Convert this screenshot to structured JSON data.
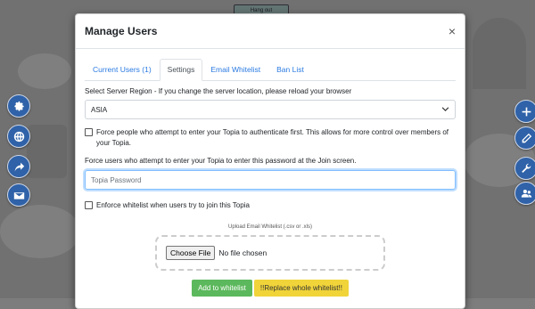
{
  "modal": {
    "title": "Manage Users",
    "close_symbol": "×",
    "tabs": [
      {
        "label": "Current Users (1)"
      },
      {
        "label": "Settings"
      },
      {
        "label": "Email Whitelist"
      },
      {
        "label": "Ban List"
      }
    ],
    "active_tab": "Settings",
    "region": {
      "label": "Select Server Region - If you change the server location, please reload your browser",
      "selected": "ASIA"
    },
    "force_auth": {
      "label": "Force people who attempt to enter your Topia to authenticate first. This allows for more control over members of your Topia.",
      "checked": false
    },
    "password": {
      "label": "Force users who attempt to enter your Topia to enter this password at the Join screen.",
      "placeholder": "Topia Password"
    },
    "whitelist_enforce": {
      "label": "Enforce whitelist when users try to join this Topia",
      "checked": false
    },
    "upload": {
      "title": "Upload Email Whitelist (.csv or .xls)",
      "button": "Choose File",
      "status": "No file chosen"
    },
    "buttons": {
      "add": "Add to whitelist",
      "replace": "!!Replace whole whitelist!!"
    }
  },
  "background": {
    "sign_text": "Hang out",
    "left_icons": [
      "gear-icon",
      "globe-icon",
      "share-icon",
      "envelope-icon"
    ],
    "right_icons": [
      "plus-icon",
      "pencil-icon",
      "wrench-icon",
      "users-icon"
    ]
  }
}
